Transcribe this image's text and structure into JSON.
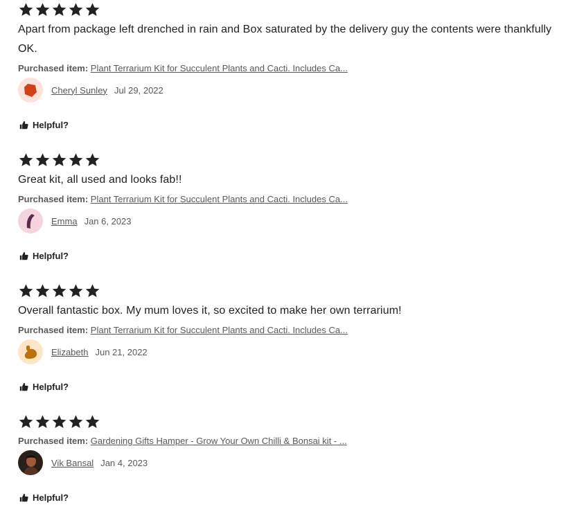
{
  "reviews": [
    {
      "rating": 5,
      "text": "Apart from package left drenched in rain and Box saturated by the delivery guy the contents were thankfully OK.",
      "purchased_label": "Purchased item:",
      "item": "Plant Terrarium Kit for Succulent Plants and Cacti. Includes Ca...",
      "author": "Cheryl Sunley",
      "date": "Jul 29, 2022",
      "helpful": "Helpful?",
      "avatar_bg": "#fbe3dc",
      "avatar_fg": "#cf4018"
    },
    {
      "rating": 5,
      "text": "Great kit, all used and looks fab!!",
      "purchased_label": "Purchased item:",
      "item": "Plant Terrarium Kit for Succulent Plants and Cacti. Includes Ca...",
      "author": "Emma",
      "date": "Jan 6, 2023",
      "helpful": "Helpful?",
      "avatar_bg": "#f6d4de",
      "avatar_fg": "#5c2a4a"
    },
    {
      "rating": 5,
      "text": "Overall fantastic box. My mum loves it, so excited to make her own terrarium!",
      "purchased_label": "Purchased item:",
      "item": "Plant Terrarium Kit for Succulent Plants and Cacti. Includes Ca...",
      "author": "Elizabeth",
      "date": "Jun 21, 2022",
      "helpful": "Helpful?",
      "avatar_bg": "#fde6c5",
      "avatar_fg": "#b8720f"
    },
    {
      "rating": 5,
      "text": "",
      "purchased_label": "Purchased item:",
      "item": "Gardening Gifts Hamper - Grow Your Own Chilli & Bonsai kit - ...",
      "author": "Vik Bansal",
      "date": "Jan 4, 2023",
      "helpful": "Helpful?",
      "avatar_bg": "#2b1f1a",
      "avatar_fg": "#a05a3a"
    }
  ],
  "icons": {
    "star": "star-icon",
    "helpful": "thumbs-up-icon"
  }
}
